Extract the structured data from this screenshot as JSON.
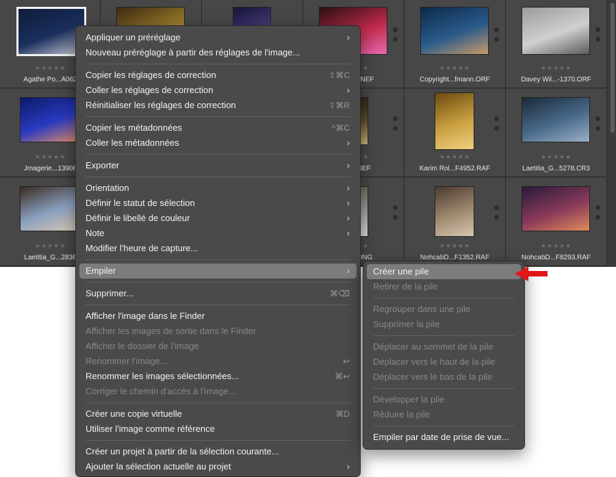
{
  "grid": {
    "rows": [
      [
        {
          "filename": "Agathe Po...A062",
          "selected": true,
          "colors": [
            "#0f1c3a",
            "#1a2f5e",
            "#c7c7d1"
          ]
        },
        {
          "filename": "",
          "selected": false,
          "colors": [
            "#3a2a10",
            "#9a7a2a",
            "#e2c26a"
          ]
        },
        {
          "filename": "",
          "selected": false,
          "colors": [
            "#15163a",
            "#4a3c7a",
            "#c79a4a"
          ]
        },
        {
          "filename": "...P7574.NEF",
          "selected": false,
          "colors": [
            "#2a1014",
            "#c02a4a",
            "#e86ab0"
          ]
        },
        {
          "filename": "Copyright...fmann.ORF",
          "selected": false,
          "colors": [
            "#0c2a4a",
            "#2a5a8a",
            "#c79a6a"
          ]
        },
        {
          "filename": "Davey Wil...-1370.ORF",
          "selected": false,
          "colors": [
            "#9a9a9a",
            "#d0d0d0",
            "#5a5a5a"
          ]
        }
      ],
      [
        {
          "filename": "Jmagerie...13908",
          "selected": false,
          "colors": [
            "#0a1a6a",
            "#2a3ac0",
            "#e08a6a"
          ]
        },
        {
          "filename": "",
          "selected": false,
          "colors": [
            "#222",
            "#333",
            "#444"
          ]
        },
        {
          "filename": "",
          "selected": false,
          "colors": [
            "#222",
            "#333",
            "#444"
          ]
        },
        {
          "filename": "...n 03.NEF",
          "selected": false,
          "colors": [
            "#1a1a12",
            "#5a4a2a",
            "#c9b47a"
          ]
        },
        {
          "filename": "Karim Rol...F4952.RAF",
          "selected": false,
          "colors": [
            "#6a4a10",
            "#c9a040",
            "#f0d080"
          ]
        },
        {
          "filename": "Laetitia_G...5278.CR3",
          "selected": false,
          "colors": [
            "#1a2a3a",
            "#4a6a8a",
            "#9ab0c6"
          ]
        }
      ],
      [
        {
          "filename": "Laetitia_G...2836",
          "selected": false,
          "colors": [
            "#3a2a20",
            "#8aa0c0",
            "#d9c8b0"
          ]
        },
        {
          "filename": "",
          "selected": false,
          "colors": [
            "#222",
            "#333",
            "#444"
          ]
        },
        {
          "filename": "",
          "selected": false,
          "colors": [
            "#222",
            "#333",
            "#444"
          ]
        },
        {
          "filename": "...0379.DNG",
          "selected": false,
          "colors": [
            "#5a5040",
            "#9aa0a0",
            "#d8dce0"
          ]
        },
        {
          "filename": "NohcabD...F1352.RAF",
          "selected": false,
          "colors": [
            "#4a3a30",
            "#a08a70",
            "#d6c6b0"
          ]
        },
        {
          "filename": "NohcabD...F8293.RAF",
          "selected": false,
          "colors": [
            "#2a1a3a",
            "#8a3a5a",
            "#e08a5a"
          ]
        }
      ]
    ],
    "rating_stars": "★★★★★"
  },
  "context_menu": {
    "items": [
      {
        "type": "item",
        "label": "Appliquer un préréglage",
        "submenu": true
      },
      {
        "type": "item",
        "label": "Nouveau préréglage à partir des réglages de l'image..."
      },
      {
        "type": "sep"
      },
      {
        "type": "item",
        "label": "Copier les réglages de correction",
        "shortcut": "⇧⌘C"
      },
      {
        "type": "item",
        "label": "Coller les réglages de correction",
        "submenu": true
      },
      {
        "type": "item",
        "label": "Réinitialiser les réglages de correction",
        "shortcut": "⇧⌘R"
      },
      {
        "type": "sep"
      },
      {
        "type": "item",
        "label": "Copier les métadonnées",
        "shortcut": "^⌘C"
      },
      {
        "type": "item",
        "label": "Coller les métadonnées",
        "submenu": true
      },
      {
        "type": "sep"
      },
      {
        "type": "item",
        "label": "Exporter",
        "submenu": true
      },
      {
        "type": "sep"
      },
      {
        "type": "item",
        "label": "Orientation",
        "submenu": true
      },
      {
        "type": "item",
        "label": "Définir le statut de sélection",
        "submenu": true
      },
      {
        "type": "item",
        "label": "Définir le libellé de couleur",
        "submenu": true
      },
      {
        "type": "item",
        "label": "Note",
        "submenu": true
      },
      {
        "type": "item",
        "label": "Modifier l'heure de capture..."
      },
      {
        "type": "sep"
      },
      {
        "type": "item",
        "label": "Empiler",
        "submenu": true,
        "highlighted": true
      },
      {
        "type": "sep"
      },
      {
        "type": "item",
        "label": "Supprimer...",
        "shortcut": "⌘⌫"
      },
      {
        "type": "sep"
      },
      {
        "type": "item",
        "label": "Afficher l'image dans le Finder"
      },
      {
        "type": "item",
        "label": "Afficher les images de sortie dans le Finder",
        "disabled": true
      },
      {
        "type": "item",
        "label": "Afficher le dossier de l'image",
        "disabled": true
      },
      {
        "type": "item",
        "label": "Renommer l'image...",
        "disabled": true,
        "shortcut": "↩"
      },
      {
        "type": "item",
        "label": "Renommer les images sélectionnées...",
        "shortcut": "⌘↩"
      },
      {
        "type": "item",
        "label": "Corriger le chemin d'accès à l'image...",
        "disabled": true
      },
      {
        "type": "sep"
      },
      {
        "type": "item",
        "label": "Créer une copie virtuelle",
        "shortcut": "⌘D"
      },
      {
        "type": "item",
        "label": "Utiliser l'image comme référence"
      },
      {
        "type": "sep"
      },
      {
        "type": "item",
        "label": "Créer un projet à partir de la sélection courante..."
      },
      {
        "type": "item",
        "label": "Ajouter la sélection actuelle au projet",
        "submenu": true
      }
    ]
  },
  "submenu": {
    "items": [
      {
        "type": "item",
        "label": "Créer une pile",
        "highlighted": true
      },
      {
        "type": "item",
        "label": "Retirer de la pile",
        "disabled": true
      },
      {
        "type": "sep"
      },
      {
        "type": "item",
        "label": "Regrouper dans une pile",
        "disabled": true
      },
      {
        "type": "item",
        "label": "Supprimer la pile",
        "disabled": true
      },
      {
        "type": "sep"
      },
      {
        "type": "item",
        "label": "Déplacer au sommet de la pile",
        "disabled": true
      },
      {
        "type": "item",
        "label": "Déplacer vers le haut de la pile",
        "disabled": true
      },
      {
        "type": "item",
        "label": "Déplacer vers le bas de la pile",
        "disabled": true
      },
      {
        "type": "sep"
      },
      {
        "type": "item",
        "label": "Développer la pile",
        "disabled": true
      },
      {
        "type": "item",
        "label": "Réduire la pile",
        "disabled": true
      },
      {
        "type": "sep"
      },
      {
        "type": "item",
        "label": "Empiler par date de prise de vue..."
      }
    ]
  },
  "submenu_chevron": "›",
  "annotation_arrow_color": "#e0161b"
}
